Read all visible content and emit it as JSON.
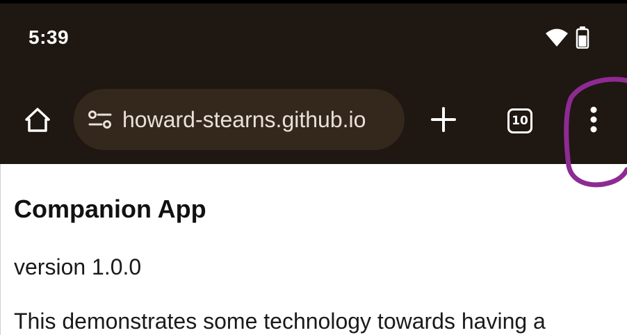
{
  "status_bar": {
    "time": "5:39",
    "icons": [
      "wifi-icon",
      "battery-icon"
    ]
  },
  "toolbar": {
    "home_icon": "home-icon",
    "site_settings_icon": "tune-icon",
    "url": "howard-stearns.github.io",
    "new_tab_icon": "plus-icon",
    "tab_count": "10",
    "menu_icon": "more-vert-icon"
  },
  "page": {
    "title": "Companion App",
    "version": "version 1.0.0",
    "description": "This demonstrates some technology towards having a"
  },
  "colors": {
    "chrome_bg": "#1f1711",
    "omnibox_bg": "#34281d",
    "annotation": "#8e2a93"
  }
}
